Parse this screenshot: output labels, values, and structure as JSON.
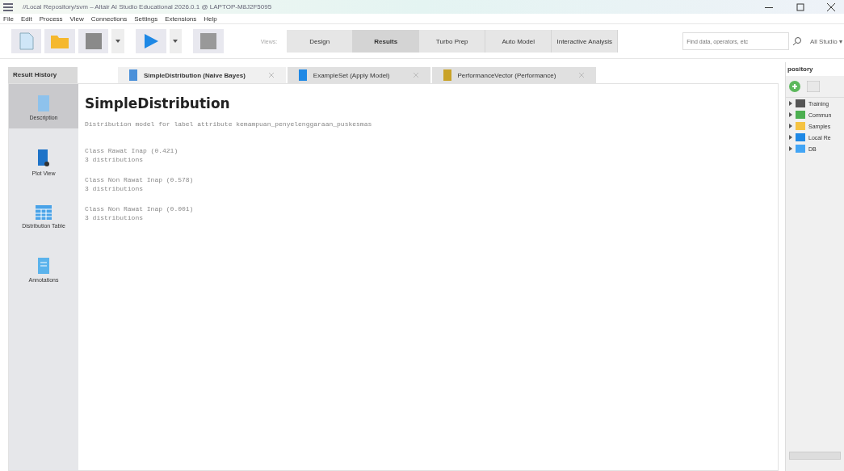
{
  "window": {
    "title": "//Local Repository/svm – Altair AI Studio Educational 2026.0.1 @ LAPTOP-M8J2F5095"
  },
  "menu": [
    "File",
    "Edit",
    "Process",
    "View",
    "Connections",
    "Settings",
    "Extensions",
    "Help"
  ],
  "views_label": "Views:",
  "views": [
    {
      "label": "Design",
      "selected": false
    },
    {
      "label": "Results",
      "selected": true
    },
    {
      "label": "Turbo Prep",
      "selected": false
    },
    {
      "label": "Auto Model",
      "selected": false
    },
    {
      "label": "Interactive Analysis",
      "selected": false
    }
  ],
  "search": {
    "placeholder": "Find data, operators, etc"
  },
  "studio_menu": "All Studio ▾",
  "result_history": "Result History",
  "tabs": [
    {
      "label": "SimpleDistribution (Naive Bayes)",
      "selected": true
    },
    {
      "label": "ExampleSet (Apply Model)",
      "selected": false
    },
    {
      "label": "PerformanceVector (Performance)",
      "selected": false
    }
  ],
  "side": [
    {
      "label": "Description",
      "selected": true
    },
    {
      "label": "Plot View",
      "selected": false
    },
    {
      "label": "Distribution Table",
      "selected": false
    },
    {
      "label": "Annotations",
      "selected": false
    }
  ],
  "content": {
    "heading": "SimpleDistribution",
    "subtitle": "Distribution model for label attribute kemampuan_penyelenggaraan_puskesmas",
    "classes": [
      {
        "name": "Class Rawat Inap (0.421)",
        "detail": "3 distributions"
      },
      {
        "name": "Class Non Rawat Inap (0.578)",
        "detail": "3 distributions"
      },
      {
        "name": "Class Non Rawat  Inap (0.001)",
        "detail": "3 distributions"
      }
    ]
  },
  "repository": {
    "title": "pository",
    "items": [
      {
        "label": "Training",
        "color": "#555555"
      },
      {
        "label": "Commun",
        "color": "#4caf50"
      },
      {
        "label": "Samples",
        "color": "#f5c342"
      },
      {
        "label": "Local Re",
        "color": "#1e88e5"
      },
      {
        "label": "DB",
        "color": "#42a5f5"
      }
    ]
  }
}
